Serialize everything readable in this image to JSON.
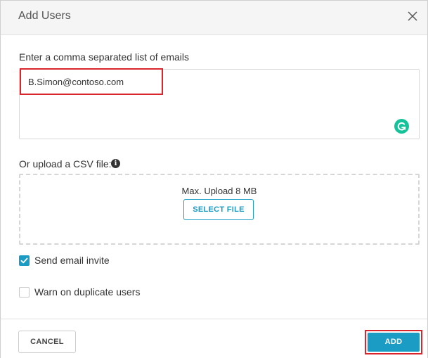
{
  "dialog": {
    "title": "Add Users",
    "close_icon": "close-icon"
  },
  "emails": {
    "label": "Enter a comma separated list of emails",
    "value": "B.Simon@contoso.com",
    "highlight_color": "#d9252b",
    "assistant_icon": "grammarly-icon"
  },
  "csv": {
    "label": "Or upload a CSV file:",
    "info_icon": "info-icon",
    "max_upload": "Max. Upload 8 MB",
    "select_file_label": "SELECT FILE"
  },
  "options": {
    "send_invite": {
      "label": "Send email invite",
      "checked": true
    },
    "warn_duplicates": {
      "label": "Warn on duplicate users",
      "checked": false
    }
  },
  "footer": {
    "cancel_label": "CANCEL",
    "add_label": "ADD"
  },
  "colors": {
    "accent": "#1a9cc5",
    "highlight": "#d9252b",
    "grammarly": "#15c39a"
  }
}
